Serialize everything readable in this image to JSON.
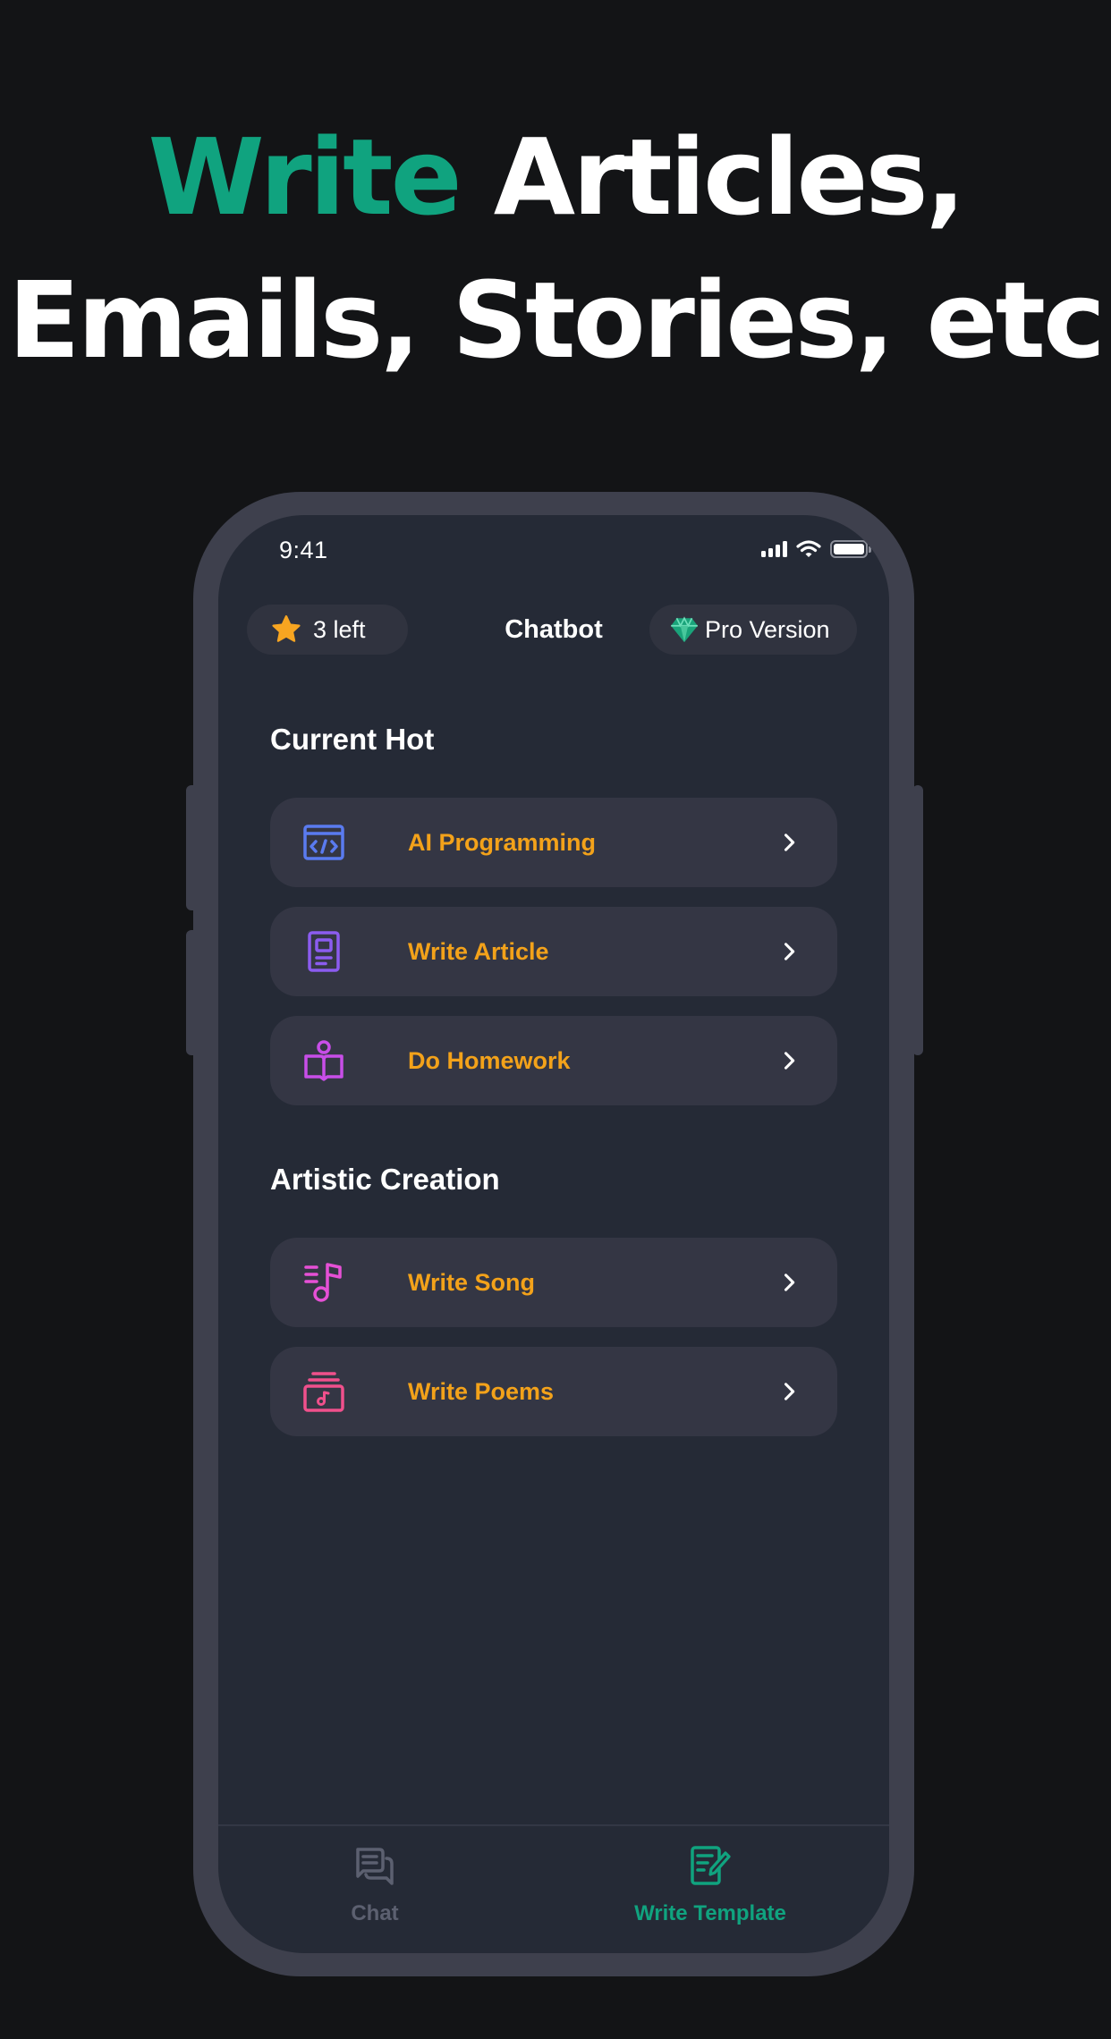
{
  "headline": {
    "line1_accent": "Write",
    "line1_rest": "Articles,",
    "line2": "Emails, Stories, etc",
    "accent_color": "#10a37f"
  },
  "status_bar": {
    "time": "9:41",
    "icons": [
      "cellular-signal-icon",
      "wifi-icon",
      "battery-icon"
    ]
  },
  "top_bar": {
    "credits_icon": "star-icon",
    "credits_label": "3 left",
    "title": "Chatbot",
    "pro_icon": "diamond-icon",
    "pro_label": "Pro Version"
  },
  "sections": [
    {
      "title": "Current Hot",
      "items": [
        {
          "label": "AI Programming",
          "icon": "code-window-icon",
          "icon_color": "#5a7bf0"
        },
        {
          "label": "Write Article",
          "icon": "document-icon",
          "icon_color": "#8b5cf0"
        },
        {
          "label": "Do Homework",
          "icon": "reading-book-icon",
          "icon_color": "#c84ee8"
        }
      ]
    },
    {
      "title": "Artistic Creation",
      "items": [
        {
          "label": "Write Song",
          "icon": "music-note-icon",
          "icon_color": "#e650d6"
        },
        {
          "label": "Write Poems",
          "icon": "music-album-icon",
          "icon_color": "#f0508c"
        }
      ]
    }
  ],
  "item_label_color": "#f3a21a",
  "tab_bar": {
    "tabs": [
      {
        "label": "Chat",
        "icon": "chat-bubbles-icon",
        "active": false
      },
      {
        "label": "Write Template",
        "icon": "write-template-icon",
        "active": true
      }
    ],
    "active_color": "#10a37f",
    "inactive_color": "#5c6070"
  }
}
